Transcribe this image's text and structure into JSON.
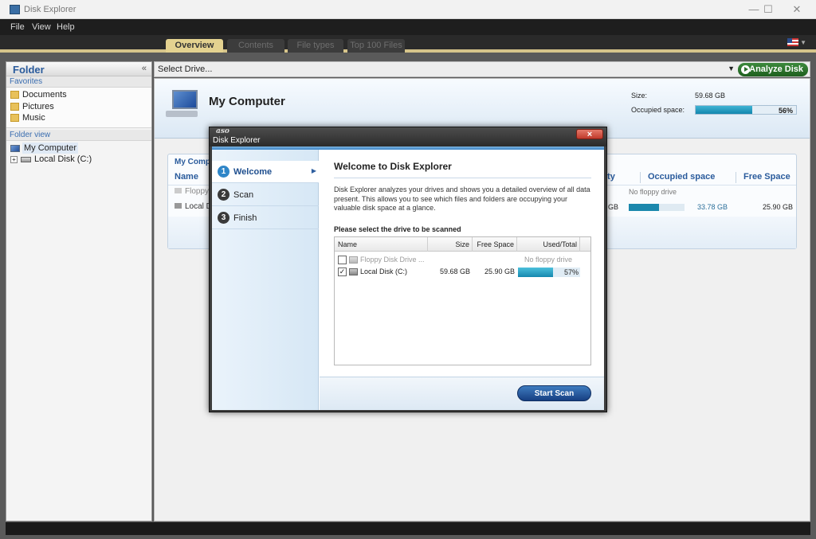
{
  "window": {
    "title": "Disk Explorer"
  },
  "menu": [
    "File",
    "View",
    "Help"
  ],
  "tabs": [
    "Overview",
    "Contents",
    "File types",
    "Top 100 Files"
  ],
  "sidebar": {
    "title": "Folder",
    "collapse_glyph": "«",
    "favorites_label": "Favorites",
    "favorites": [
      "Documents",
      "Pictures",
      "Music"
    ],
    "folder_view_label": "Folder view",
    "tree": [
      {
        "label": "My Computer",
        "icon": "computer-icon"
      },
      {
        "label": "Local Disk (C:)",
        "icon": "hard-drive-icon"
      }
    ]
  },
  "drivebar": {
    "label": "Select Drive...",
    "analyze_label": "Analyze Disk"
  },
  "overview": {
    "title": "My Computer",
    "size_label": "Size:",
    "size_value": "59.68 GB",
    "occupied_label": "Occupied space:",
    "occupied_pct_text": "56%",
    "occupied_fraction": 0.56
  },
  "mc_table": {
    "heading": "My Compu",
    "col_name": "Name",
    "col_capacity_tail": "ity",
    "col_occupied": "Occupied space",
    "col_free": "Free Space",
    "rows": [
      {
        "name": "Floppy",
        "occupied": "No floppy drive"
      },
      {
        "name": "Local D",
        "capacity_tail": "GB",
        "occupied": "33.78 GB",
        "free": "25.90 GB",
        "used_fraction": 0.56
      }
    ]
  },
  "dialog": {
    "brand": "aso",
    "title": "Disk Explorer",
    "close_glyph": "×",
    "steps": [
      {
        "num": "1",
        "label": "Welcome",
        "active": true
      },
      {
        "num": "2",
        "label": "Scan",
        "active": false
      },
      {
        "num": "3",
        "label": "Finish",
        "active": false
      }
    ],
    "heading": "Welcome to Disk Explorer",
    "description": "Disk Explorer analyzes your drives and shows you a detailed overview of all data present.  This allows you to see which files and folders are occupying your valuable disk space at a glance.",
    "prompt": "Please select the drive to be scanned",
    "table": {
      "columns": [
        "Name",
        "Size",
        "Free Space",
        "Used/Total"
      ],
      "rows": [
        {
          "checked": false,
          "check_glyph": "",
          "name": "Floppy Disk Drive ...",
          "size": "",
          "free": "",
          "used_text": "No floppy drive",
          "disabled": true
        },
        {
          "checked": true,
          "check_glyph": "✓",
          "name": "Local Disk (C:)",
          "size": "59.68 GB",
          "free": "25.90 GB",
          "used_text": "57%",
          "used_fraction": 0.57,
          "disabled": false
        }
      ]
    },
    "start_label": "Start Scan"
  },
  "colors": {
    "accent": "#2f86c8",
    "bar": "#1386ad",
    "analyze": "#2b6e2b"
  }
}
